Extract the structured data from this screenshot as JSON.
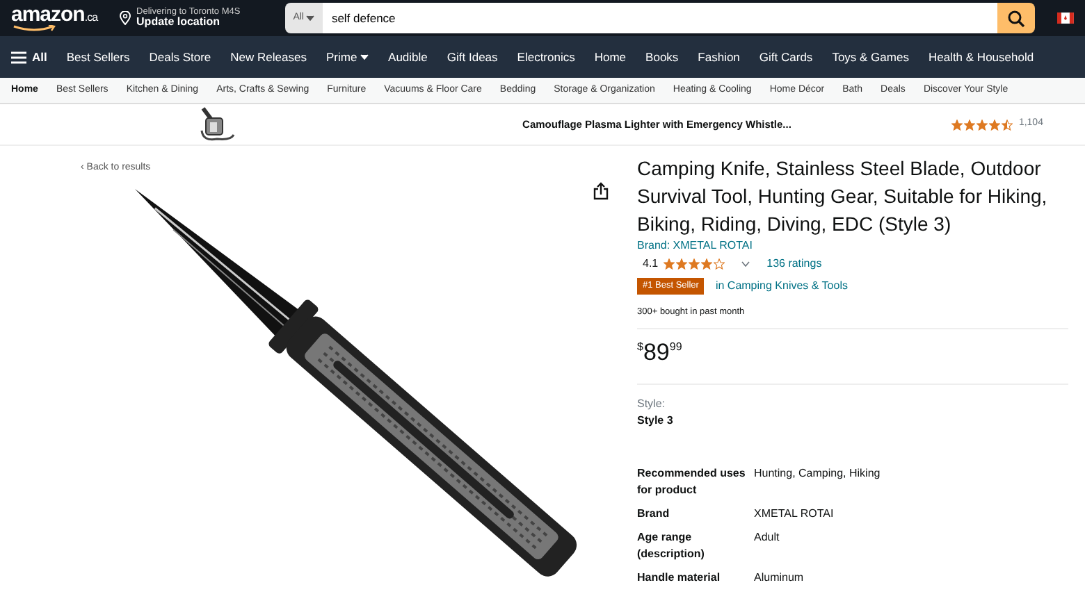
{
  "header": {
    "logo": "amazon",
    "logo_suffix": ".ca",
    "deliver_line": "Delivering to Toronto M4S",
    "location": "Update location",
    "search": {
      "category": "All",
      "value": "self defence"
    }
  },
  "main_nav": [
    {
      "label": "All",
      "kind": "menu"
    },
    {
      "label": "Best Sellers",
      "kind": "link"
    },
    {
      "label": "Deals Store",
      "kind": "link"
    },
    {
      "label": "New Releases",
      "kind": "link"
    },
    {
      "label": "Prime",
      "kind": "dropdown"
    },
    {
      "label": "Audible",
      "kind": "link"
    },
    {
      "label": "Gift Ideas",
      "kind": "link"
    },
    {
      "label": "Electronics",
      "kind": "link"
    },
    {
      "label": "Home",
      "kind": "link"
    },
    {
      "label": "Books",
      "kind": "link"
    },
    {
      "label": "Fashion",
      "kind": "link"
    },
    {
      "label": "Gift Cards",
      "kind": "link"
    },
    {
      "label": "Toys & Games",
      "kind": "link"
    },
    {
      "label": "Health & Household",
      "kind": "link"
    }
  ],
  "sub_nav": [
    {
      "label": "Home",
      "selected": true
    },
    {
      "label": "Best Sellers",
      "selected": false
    },
    {
      "label": "Kitchen & Dining",
      "selected": false
    },
    {
      "label": "Arts, Crafts & Sewing",
      "selected": false
    },
    {
      "label": "Furniture",
      "selected": false
    },
    {
      "label": "Vacuums & Floor Care",
      "selected": false
    },
    {
      "label": "Bedding",
      "selected": false
    },
    {
      "label": "Storage & Organization",
      "selected": false
    },
    {
      "label": "Heating & Cooling",
      "selected": false
    },
    {
      "label": "Home Décor",
      "selected": false
    },
    {
      "label": "Bath",
      "selected": false
    },
    {
      "label": "Deals",
      "selected": false
    },
    {
      "label": "Discover Your Style",
      "selected": false
    }
  ],
  "sponsored": {
    "title": "Camouflage Plasma Lighter with Emergency Whistle...",
    "stars": 4.5,
    "count": "1,104"
  },
  "back_link": "‹ Back to results",
  "product": {
    "title": "Camping Knife, Stainless Steel Blade, Outdoor Survival Tool, Hunting Gear, Suitable for Hiking, Biking, Riding, Diving, EDC (Style 3)",
    "brand": "Brand: XMETAL ROTAI",
    "rating": "4.1",
    "stars": 4,
    "ratings": "136 ratings",
    "badge": "#1 Best Seller",
    "badge_category": "in Camping Knives & Tools",
    "bought": "300+ bought in past month",
    "price": {
      "symbol": "$",
      "whole": "89",
      "fraction": "99"
    },
    "style_label": "Style:",
    "style_value": "Style 3",
    "specs": [
      {
        "label": "Recommended uses for product",
        "value": "Hunting, Camping, Hiking"
      },
      {
        "label": "Brand",
        "value": "XMETAL ROTAI"
      },
      {
        "label": "Age range (description)",
        "value": "Adult"
      },
      {
        "label": "Handle material",
        "value": "Aluminum"
      }
    ]
  }
}
